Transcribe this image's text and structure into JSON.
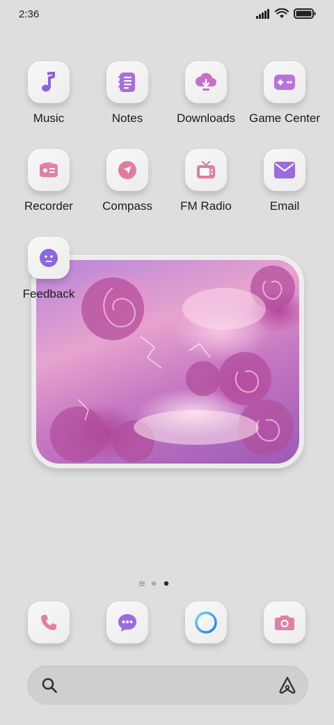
{
  "status_bar": {
    "time": "2:36",
    "icons": [
      "signal-icon",
      "wifi-icon",
      "battery-icon"
    ]
  },
  "apps": [
    {
      "label": "Music",
      "icon": "music-note-icon",
      "color": "#8a63d8"
    },
    {
      "label": "Notes",
      "icon": "notes-icon",
      "color": "#a86ee0"
    },
    {
      "label": "Downloads",
      "icon": "download-cloud-icon",
      "color": "#c66fc8"
    },
    {
      "label": "Game Center",
      "icon": "gamepad-icon",
      "color": "#b872e0"
    },
    {
      "label": "Recorder",
      "icon": "recorder-icon",
      "color": "#e27ea8"
    },
    {
      "label": "Compass",
      "icon": "compass-icon",
      "color": "#e07ca2"
    },
    {
      "label": "FM Radio",
      "icon": "radio-icon",
      "color": "#e07ca2"
    },
    {
      "label": "Email",
      "icon": "email-icon",
      "color": "#9b6be0"
    },
    {
      "label": "Feedback",
      "icon": "feedback-face-icon",
      "color": "#8b67e0"
    }
  ],
  "widget": {
    "subject": "photo-widget"
  },
  "page_indicator": {
    "pages": 3,
    "current": 3
  },
  "dock": [
    {
      "icon": "phone-icon",
      "color": "#e27ea8"
    },
    {
      "icon": "messages-icon",
      "color": "#9b6be0"
    },
    {
      "icon": "browser-icon",
      "color": "#2f9bf0"
    },
    {
      "icon": "camera-icon",
      "color": "#e27ea8"
    }
  ],
  "search": {
    "icon": "search-icon",
    "assistant_icon": "assistant-icon"
  }
}
